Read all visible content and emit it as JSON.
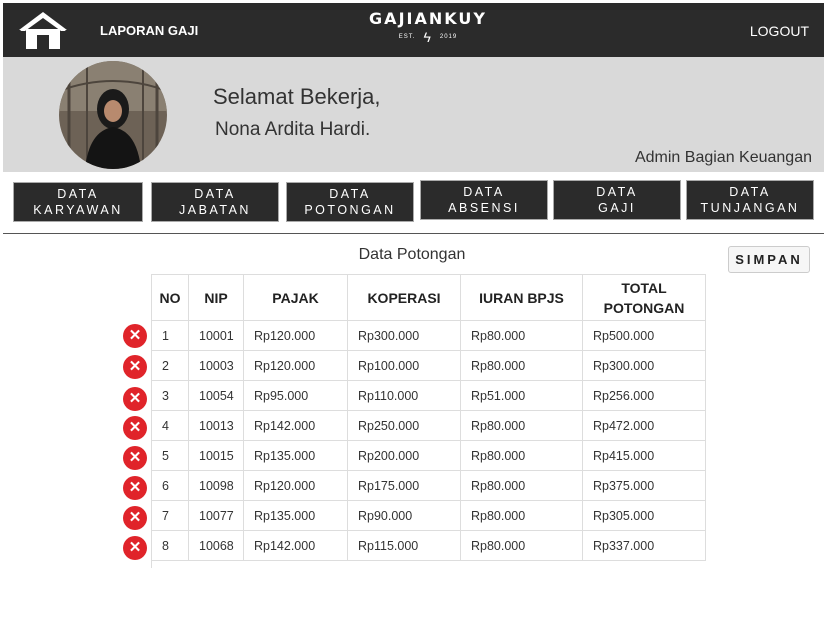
{
  "navbar": {
    "laporan": "LAPORAN GAJI",
    "brand": "GAJIANKUY",
    "brand_est": "EST.",
    "brand_year": "2019",
    "logout": "LOGOUT"
  },
  "profile": {
    "greeting": "Selamat Bekerja,",
    "name": "Nona Ardita Hardi.",
    "role": "Admin Bagian Keuangan"
  },
  "menu": [
    {
      "line1": "DATA",
      "line2": "KARYAWAN"
    },
    {
      "line1": "DATA",
      "line2": "JABATAN"
    },
    {
      "line1": "DATA",
      "line2": "POTONGAN"
    },
    {
      "line1": "DATA",
      "line2": "ABSENSI"
    },
    {
      "line1": "DATA",
      "line2": "GAJI"
    },
    {
      "line1": "DATA",
      "line2": "TUNJANGAN"
    }
  ],
  "section": {
    "title": "Data Potongan",
    "save": "SIMPAN"
  },
  "table": {
    "headers": [
      "NO",
      "NIP",
      "PAJAK",
      "KOPERASI",
      "IURAN BPJS",
      "TOTAL POTONGAN"
    ],
    "rows": [
      [
        "1",
        "10001",
        "Rp120.000",
        "Rp300.000",
        "Rp80.000",
        "Rp500.000"
      ],
      [
        "2",
        "10003",
        "Rp120.000",
        "Rp100.000",
        "Rp80.000",
        "Rp300.000"
      ],
      [
        "3",
        "10054",
        "Rp95.000",
        "Rp110.000",
        "Rp51.000",
        "Rp256.000"
      ],
      [
        "4",
        "10013",
        "Rp142.000",
        "Rp250.000",
        "Rp80.000",
        "Rp472.000"
      ],
      [
        "5",
        "10015",
        "Rp135.000",
        "Rp200.000",
        "Rp80.000",
        "Rp415.000"
      ],
      [
        "6",
        "10098",
        "Rp120.000",
        "Rp175.000",
        "Rp80.000",
        "Rp375.000"
      ],
      [
        "7",
        "10077",
        "Rp135.000",
        "Rp90.000",
        "Rp80.000",
        "Rp305.000"
      ],
      [
        "8",
        "10068",
        "Rp142.000",
        "Rp115.000",
        "Rp80.000",
        "Rp337.000"
      ]
    ]
  },
  "icons": {
    "home": "home-icon",
    "delete": "delete-icon",
    "avatar": "avatar-photo"
  },
  "colors": {
    "navbar": "#2b2b2b",
    "profile_band": "#d9d9d9",
    "delete": "#e0242a"
  }
}
